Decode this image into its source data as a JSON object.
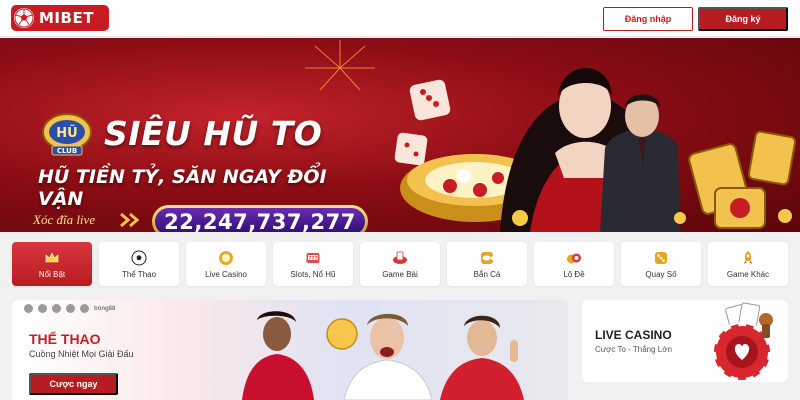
{
  "colors": {
    "brand": "#c61d24",
    "brand_dark": "#b71c22",
    "jackpot_bg": "#3a1484",
    "gold": "#f2c14e"
  },
  "header": {
    "logo_text": "MIBET",
    "logo_icon": "soccer-ball-icon",
    "login_label": "Đăng nhập",
    "register_label": "Đăng ký"
  },
  "hero": {
    "badge_top": "HŨ",
    "badge_bottom": "CLUB",
    "title": "SIÊU HŨ TO",
    "subtitle": "HŨ TIỀN TỶ, SĂN NGAY ĐỔI VẬN",
    "game_label": "Xóc đĩa live",
    "jackpot_value": "22,247,737,277",
    "slide_count": 4,
    "active_slide": 1
  },
  "categories": [
    {
      "label": "Nổi Bật",
      "icon": "crown-icon",
      "active": true
    },
    {
      "label": "Thể Thao",
      "icon": "soccer-ball-icon",
      "active": false
    },
    {
      "label": "Live Casino",
      "icon": "poker-chip-icon",
      "active": false
    },
    {
      "label": "Slots, Nổ Hũ",
      "icon": "slot-machine-icon",
      "active": false
    },
    {
      "label": "Game Bài",
      "icon": "cards-icon",
      "active": false
    },
    {
      "label": "Bắn Cá",
      "icon": "fish-icon",
      "active": false
    },
    {
      "label": "Lô Đề",
      "icon": "lottery-ball-icon",
      "active": false
    },
    {
      "label": "Quay Số",
      "icon": "dice-icon",
      "active": false
    },
    {
      "label": "Game Khác",
      "icon": "rocket-icon",
      "active": false
    }
  ],
  "sport_card": {
    "title": "THỂ THAO",
    "subtitle": "Cuồng Nhiệt Mọi Giải Đấu",
    "button_label": "Cược ngay",
    "partner_tag": "bóng88"
  },
  "casino_card": {
    "title": "LIVE CASINO",
    "subtitle": "Cược To - Thắng Lớn"
  }
}
